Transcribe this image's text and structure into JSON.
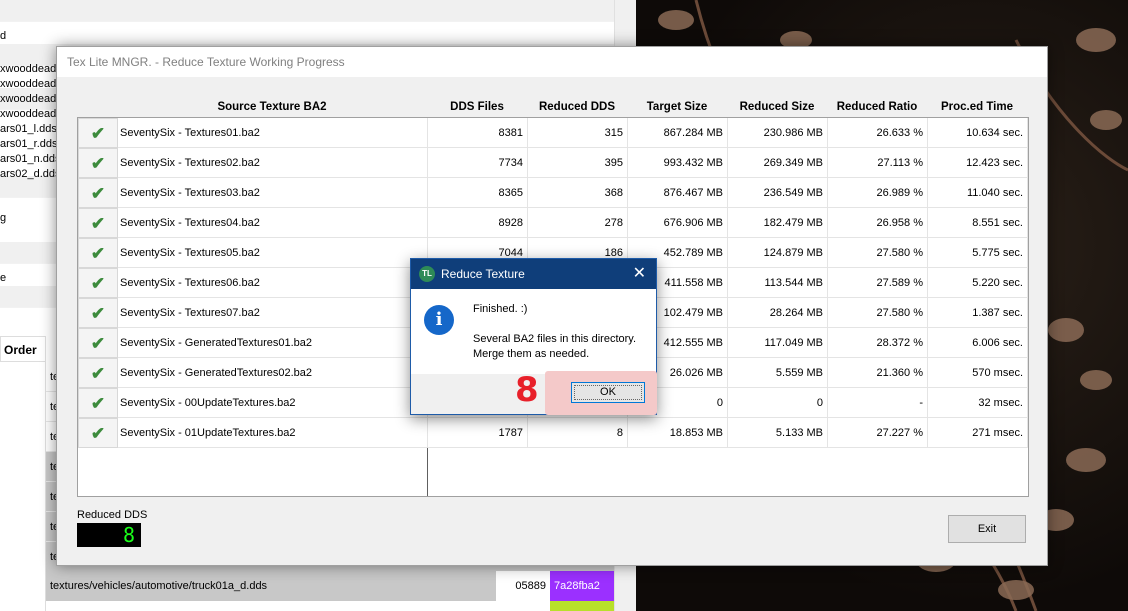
{
  "background_app": {
    "left_fragments": [
      "d",
      "xwooddead",
      "xwooddead",
      "xwooddead",
      "xwooddead",
      "ars01_l.dds",
      "ars01_r.dds",
      "ars01_n.dds",
      "ars02_d.dds",
      "g",
      "e"
    ],
    "order_header": "Order",
    "row_prefix": "te",
    "bottom_path": "textures/vehicles/automotive/truck01a_d.dds",
    "bottom_number": "05889",
    "bottom_hash": "7a28fba2",
    "colors": {
      "hash_bg": "#9b30ff",
      "strip": "#b8e02a"
    }
  },
  "main_window": {
    "title": "Tex Lite MNGR. - Reduce Texture Working Progress",
    "columns": [
      "Source Texture BA2",
      "DDS Files",
      "Reduced DDS",
      "Target Size",
      "Reduced Size",
      "Reduced Ratio",
      "Proc.ed Time"
    ],
    "rows": [
      {
        "name": "SeventySix - Textures01.ba2",
        "dds": "8381",
        "reduced": "315",
        "target": "867.284 MB",
        "reduced_size": "230.986 MB",
        "ratio": "26.633 %",
        "time": "10.634 sec."
      },
      {
        "name": "SeventySix - Textures02.ba2",
        "dds": "7734",
        "reduced": "395",
        "target": "993.432 MB",
        "reduced_size": "269.349 MB",
        "ratio": "27.113 %",
        "time": "12.423 sec."
      },
      {
        "name": "SeventySix - Textures03.ba2",
        "dds": "8365",
        "reduced": "368",
        "target": "876.467 MB",
        "reduced_size": "236.549 MB",
        "ratio": "26.989 %",
        "time": "11.040 sec."
      },
      {
        "name": "SeventySix - Textures04.ba2",
        "dds": "8928",
        "reduced": "278",
        "target": "676.906 MB",
        "reduced_size": "182.479 MB",
        "ratio": "26.958 %",
        "time": "8.551 sec."
      },
      {
        "name": "SeventySix - Textures05.ba2",
        "dds": "7044",
        "reduced": "186",
        "target": "452.789 MB",
        "reduced_size": "124.879 MB",
        "ratio": "27.580 %",
        "time": "5.775 sec."
      },
      {
        "name": "SeventySix - Textures06.ba2",
        "dds": "",
        "reduced": "",
        "target": "411.558 MB",
        "reduced_size": "113.544 MB",
        "ratio": "27.589 %",
        "time": "5.220 sec."
      },
      {
        "name": "SeventySix - Textures07.ba2",
        "dds": "",
        "reduced": "",
        "target": "102.479 MB",
        "reduced_size": "28.264 MB",
        "ratio": "27.580 %",
        "time": "1.387 sec."
      },
      {
        "name": "SeventySix - GeneratedTextures01.ba2",
        "dds": "",
        "reduced": "",
        "target": "412.555 MB",
        "reduced_size": "117.049 MB",
        "ratio": "28.372 %",
        "time": "6.006 sec."
      },
      {
        "name": "SeventySix - GeneratedTextures02.ba2",
        "dds": "",
        "reduced": "",
        "target": "26.026 MB",
        "reduced_size": "5.559 MB",
        "ratio": "21.360 %",
        "time": "570 msec."
      },
      {
        "name": "SeventySix - 00UpdateTextures.ba2",
        "dds": "",
        "reduced": "",
        "target": "0",
        "reduced_size": "0",
        "ratio": "-",
        "time": "32 msec."
      },
      {
        "name": "SeventySix - 01UpdateTextures.ba2",
        "dds": "1787",
        "reduced": "8",
        "target": "18.853 MB",
        "reduced_size": "5.133 MB",
        "ratio": "27.227 %",
        "time": "271 msec."
      }
    ],
    "check_glyph": "✔",
    "reduced_dds_label": "Reduced DDS",
    "reduced_dds_value": "8",
    "exit_label": "Exit"
  },
  "dialog": {
    "title": "Reduce Texture",
    "close_glyph": "✕",
    "info_glyph": "i",
    "message_line1": "Finished. :)",
    "message_line2": "Several BA2 files in this directory.",
    "message_line3": "Merge them as needed.",
    "ok_label": "OK"
  },
  "annotation": {
    "step_number": "8",
    "color": "#e8202a"
  }
}
